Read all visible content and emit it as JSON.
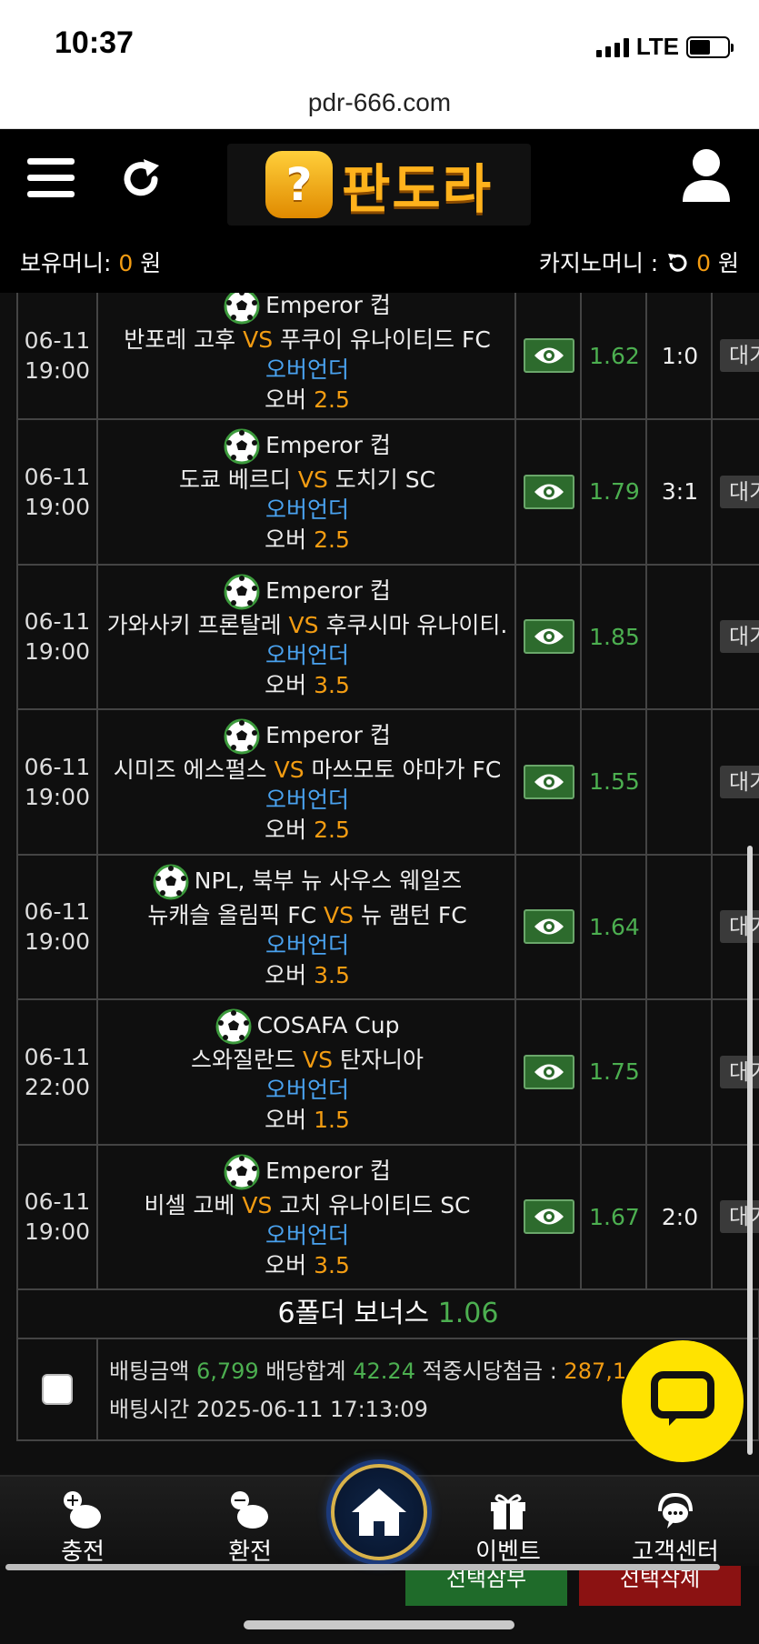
{
  "status_bar": {
    "time": "10:37",
    "network": "LTE"
  },
  "url": "pdr-666.com",
  "header": {
    "logo_text": "판도라",
    "logo_badge": "?",
    "money_label": "보유머니: ",
    "money_value": "0",
    "money_unit": " 원",
    "casino_label": "카지노머니 : ",
    "casino_value": "0",
    "casino_unit": " 원"
  },
  "bets": [
    {
      "date": "06-11",
      "time": "19:00",
      "league": "Emperor 컵",
      "home": "반포레 고후",
      "vs": "VS",
      "away": "푸쿠이 유나이티드 FC",
      "market": "오버언더",
      "pick": "오버",
      "line": "2.5",
      "odds": "1.62",
      "score": "1:0",
      "status": "대기"
    },
    {
      "date": "06-11",
      "time": "19:00",
      "league": "Emperor 컵",
      "home": "도쿄 베르디",
      "vs": "VS",
      "away": "도치기 SC",
      "market": "오버언더",
      "pick": "오버",
      "line": "2.5",
      "odds": "1.79",
      "score": "3:1",
      "status": "대기"
    },
    {
      "date": "06-11",
      "time": "19:00",
      "league": "Emperor 컵",
      "home": "가와사키 프론탈레",
      "vs": "VS",
      "away": "후쿠시마 유나이티.",
      "market": "오버언더",
      "pick": "오버",
      "line": "3.5",
      "odds": "1.85",
      "score": "",
      "status": "대기"
    },
    {
      "date": "06-11",
      "time": "19:00",
      "league": "Emperor 컵",
      "home": "시미즈 에스펄스",
      "vs": "VS",
      "away": "마쓰모토 야마가 FC",
      "market": "오버언더",
      "pick": "오버",
      "line": "2.5",
      "odds": "1.55",
      "score": "",
      "status": "대기"
    },
    {
      "date": "06-11",
      "time": "19:00",
      "league": "NPL, 북부 뉴 사우스 웨일즈",
      "home": "뉴캐슬 올림픽 FC",
      "vs": "VS",
      "away": "뉴 램턴 FC",
      "market": "오버언더",
      "pick": "오버",
      "line": "3.5",
      "odds": "1.64",
      "score": "",
      "status": "대기"
    },
    {
      "date": "06-11",
      "time": "22:00",
      "league": "COSAFA Cup",
      "home": "스와질란드",
      "vs": "VS",
      "away": "탄자니아",
      "market": "오버언더",
      "pick": "오버",
      "line": "1.5",
      "odds": "1.75",
      "score": "",
      "status": "대기"
    },
    {
      "date": "06-11",
      "time": "19:00",
      "league": "Emperor 컵",
      "home": "비셀 고베",
      "vs": "VS",
      "away": "고치 유나이티드 SC",
      "market": "오버언더",
      "pick": "오버",
      "line": "3.5",
      "odds": "1.67",
      "score": "2:0",
      "status": "대기"
    }
  ],
  "bonus": {
    "label": "6폴더 보너스 ",
    "value": "1.06"
  },
  "summary": {
    "amount_label": "배팅금액 ",
    "amount": "6,799",
    "total_odds_label": " 배당합계 ",
    "total_odds": "42.24",
    "win_label": " 적중시당첨금 : ",
    "win": "287,1",
    "time_label": "배팅시간 ",
    "time": "2025-06-11 17:13:09"
  },
  "nav": {
    "charge": "충전",
    "exchange": "환전",
    "event": "이벤트",
    "support": "고객센터"
  },
  "under_buttons": {
    "select_all": "선택삼부",
    "delete_selected": "선택삭제"
  },
  "colors": {
    "accent_orange": "#f39c12",
    "odds_green": "#4caf50",
    "market_blue": "#4aa3f0",
    "chat_yellow": "#ffe300"
  }
}
